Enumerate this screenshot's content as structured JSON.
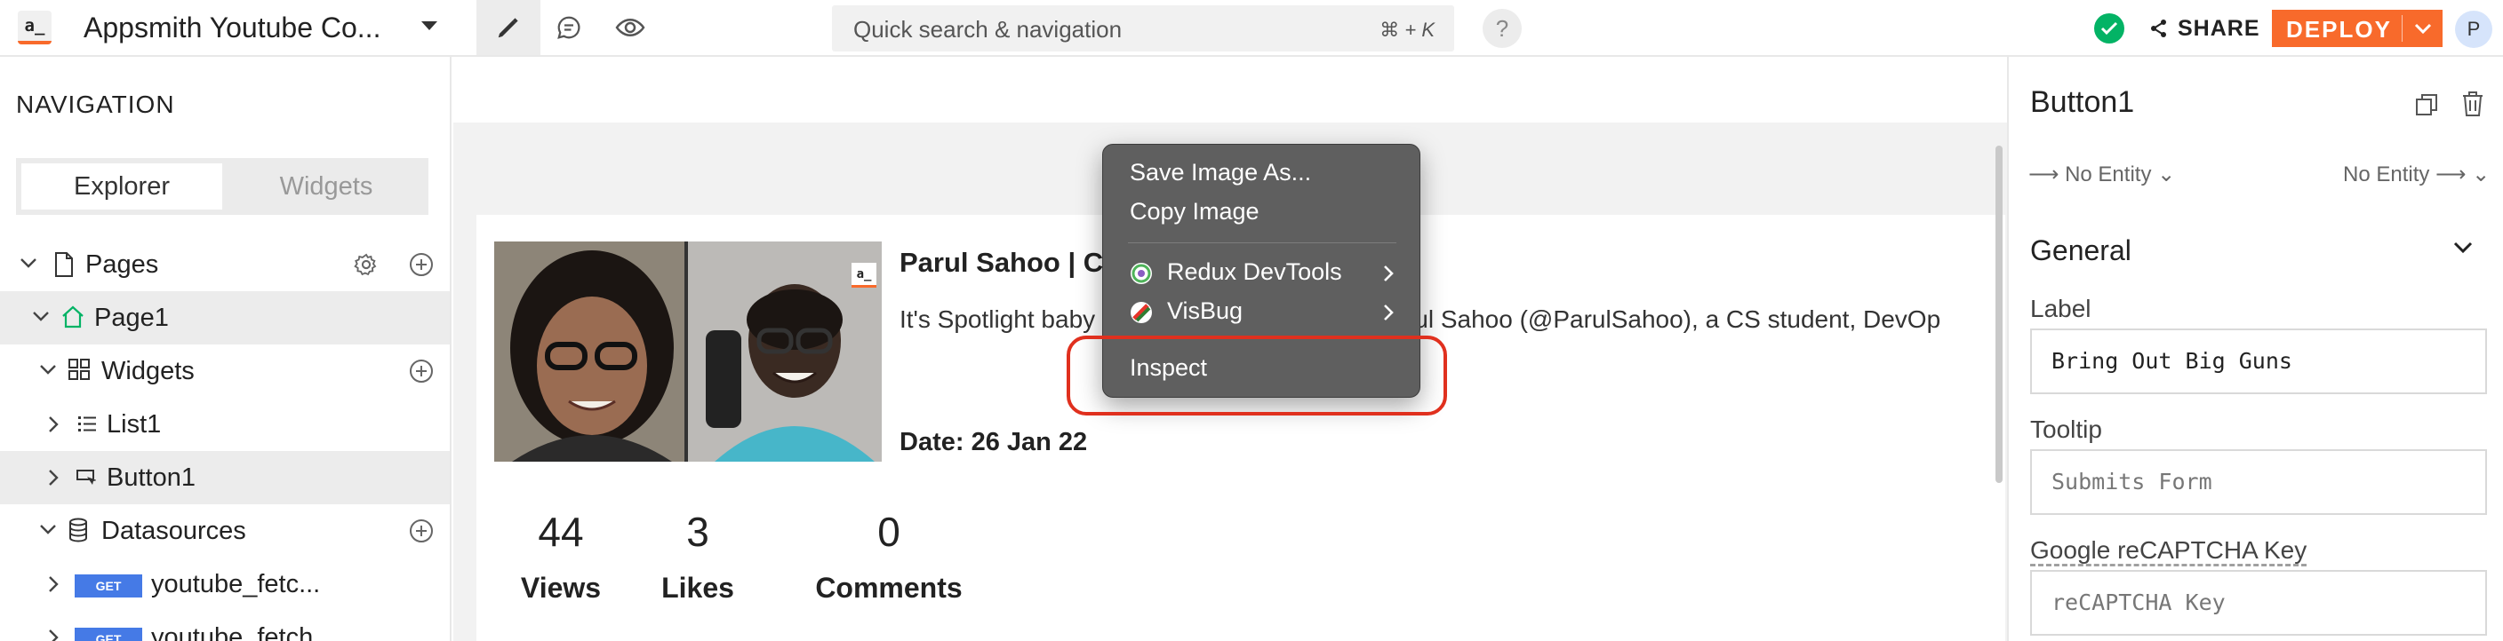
{
  "topbar": {
    "logo_text": "a_",
    "app_name": "Appsmith Youtube Co...",
    "search_placeholder": "Quick search & navigation",
    "search_shortcut": "⌘ + K",
    "help_text": "?",
    "share_label": "SHARE",
    "deploy_label": "DEPLOY",
    "avatar_initial": "P"
  },
  "nav": {
    "title": "NAVIGATION",
    "tabs": {
      "explorer": "Explorer",
      "widgets": "Widgets"
    },
    "tree": {
      "pages": "Pages",
      "page1": "Page1",
      "widgets": "Widgets",
      "list1": "List1",
      "button1": "Button1",
      "datasources": "Datasources",
      "ds1_method": "GET",
      "ds1_name": "youtube_fetc...",
      "ds2_method": "GET",
      "ds2_name": "youtube_fetch"
    }
  },
  "canvas": {
    "thumb_logo": "a_",
    "video_title": "Parul Sahoo | C",
    "video_desc": "It's Spotlight baby",
    "video_desc_tail": "Parul Sahoo (@ParulSahoo), a CS student, DevOp",
    "video_date": "Date: 26 Jan 22",
    "stats": [
      {
        "value": "44",
        "label": "Views"
      },
      {
        "value": "3",
        "label": "Likes"
      },
      {
        "value": "0",
        "label": "Comments"
      }
    ]
  },
  "context_menu": {
    "save_image": "Save Image As...",
    "copy_image": "Copy Image",
    "redux": "Redux DevTools",
    "visbug": "VisBug",
    "inspect": "Inspect"
  },
  "properties": {
    "widget_name": "Button1",
    "entity_left": "No Entity",
    "entity_right": "No Entity",
    "section": "General",
    "label_title": "Label",
    "label_value": "Bring Out Big Guns",
    "tooltip_title": "Tooltip",
    "tooltip_placeholder": "Submits Form",
    "recaptcha_title": "Google reCAPTCHA Key",
    "recaptcha_placeholder": "reCAPTCHA Key"
  },
  "colors": {
    "brand_orange": "#f86a2b",
    "success_green": "#03b365",
    "get_badge_blue": "#457ae6",
    "highlight_red": "#e0301e"
  },
  "icons": [
    "appsmith-logo-icon",
    "pencil-icon",
    "comment-icon",
    "eye-icon",
    "check-icon",
    "share-icon",
    "chevron-down-icon",
    "page-icon",
    "gear-icon",
    "plus-icon",
    "home-icon",
    "grid-icon",
    "list-icon",
    "button-icon",
    "database-icon",
    "copy-icon",
    "trash-icon",
    "arrow-right-icon"
  ]
}
